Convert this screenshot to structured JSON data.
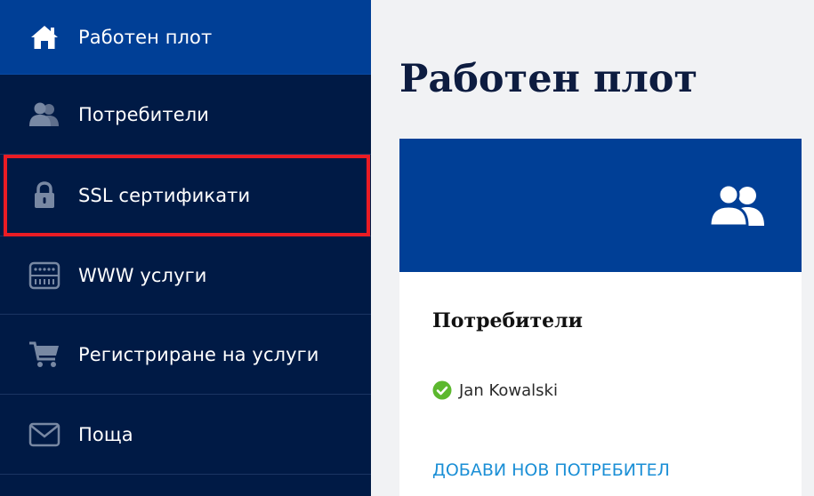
{
  "sidebar": {
    "items": [
      {
        "label": "Работен плот",
        "icon": "home-icon",
        "active": true
      },
      {
        "label": "Потребители",
        "icon": "users-icon"
      },
      {
        "label": "SSL сертификати",
        "icon": "lock-icon",
        "highlighted": true
      },
      {
        "label": "WWW услуги",
        "icon": "server-icon"
      },
      {
        "label": "Регистриране на услуги",
        "icon": "cart-icon"
      },
      {
        "label": "Поща",
        "icon": "envelope-icon"
      }
    ]
  },
  "main": {
    "title": "Работен плот",
    "card": {
      "icon": "users-icon",
      "title": "Потребители",
      "users": [
        {
          "name": "Jan Kowalski",
          "status_icon": "check-circle-icon"
        }
      ],
      "add_link": "ДОБАВИ НОВ ПОТРЕБИТЕЛ"
    }
  },
  "colors": {
    "sidebar_bg": "#001a45",
    "active_bg": "#003f96",
    "highlight": "#ea1c24",
    "link": "#1b8fd6",
    "check": "#5cb82e"
  }
}
